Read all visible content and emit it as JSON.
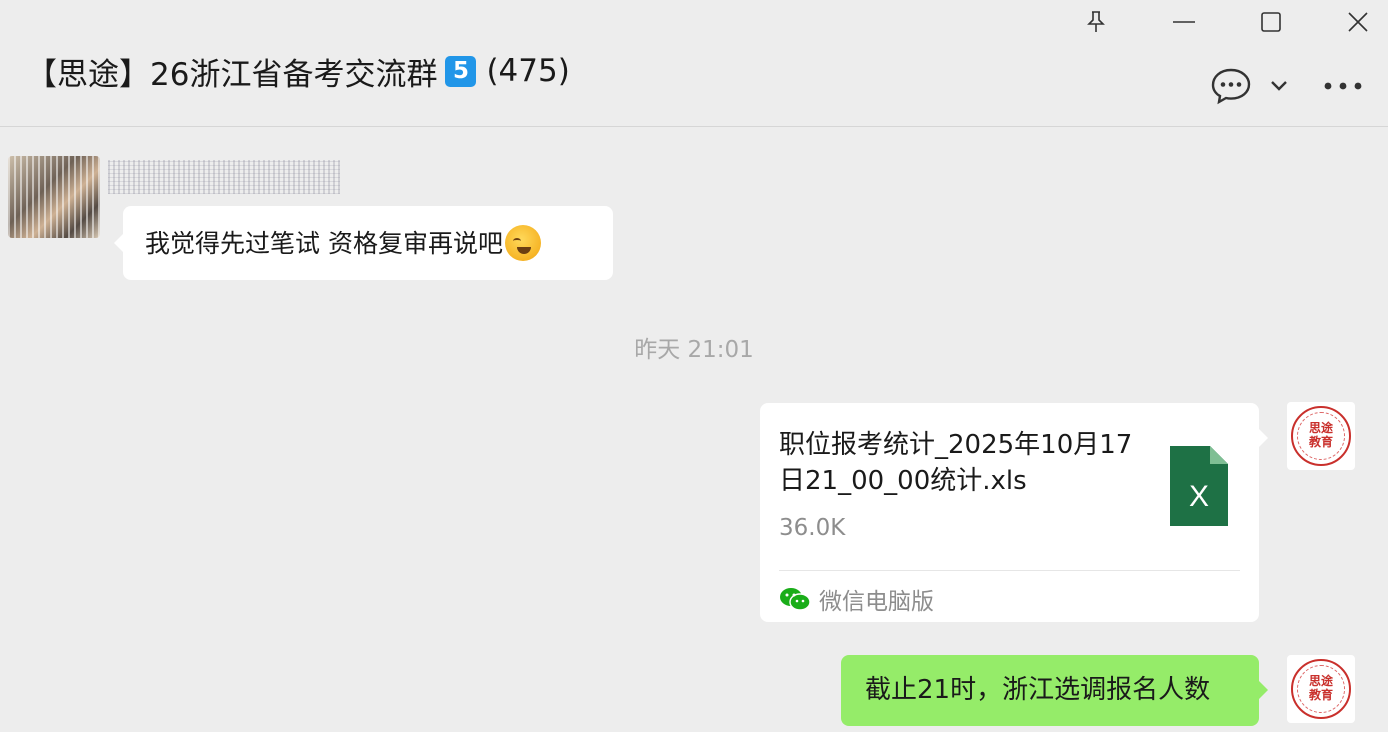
{
  "window": {
    "controls": {
      "pin_icon": "pin-icon",
      "minimize_icon": "minimize-icon",
      "maximize_icon": "maximize-icon",
      "close_icon": "close-icon"
    }
  },
  "header": {
    "title": "【思途】26浙江省备考交流群",
    "badge": "5",
    "member_count": "(475)",
    "actions": [
      "chat-bubble-icon",
      "chevron-down-icon",
      "more-icon"
    ]
  },
  "messages": [
    {
      "side": "left",
      "sender": "",
      "text": "我觉得先过笔试 资格复审再说吧",
      "emoji": "crying-laughing-emoji"
    },
    {
      "type": "timestamp",
      "text": "昨天 21:01"
    },
    {
      "side": "right",
      "type": "file",
      "file_name": "职位报考统计_2025年10月17日21_00_00统计.xls",
      "file_size": "36.0K",
      "source": "微信电脑版",
      "file_icon": "excel-file-icon",
      "avatar_text": [
        "思途",
        "教育"
      ]
    },
    {
      "side": "right",
      "text": "截止21时，浙江选调报名人数",
      "avatar_text": [
        "思途",
        "教育"
      ]
    }
  ],
  "colors": {
    "background": "#ededed",
    "bubble_self": "#95ec69",
    "bubble_other": "#ffffff",
    "badge": "#2196e8",
    "excel_green": "#1e7145",
    "seal_red": "#c9302c"
  }
}
